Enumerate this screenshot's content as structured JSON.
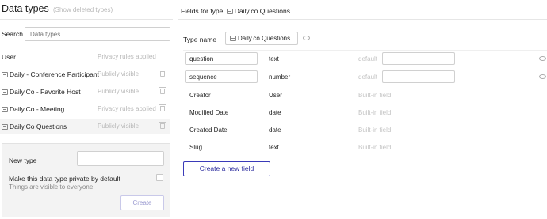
{
  "left": {
    "title": "Data types",
    "show_deleted": "(Show deleted types)",
    "search": {
      "label": "Search",
      "placeholder": "Data types"
    },
    "types": [
      {
        "name": "User",
        "status": "Privacy rules applied",
        "icon": false,
        "trash": false
      },
      {
        "name": "Daily - Conference Participant",
        "status": "Publicly visible",
        "icon": true,
        "trash": true
      },
      {
        "name": "Daily.Co - Favorite Host",
        "status": "Publicly visible",
        "icon": true,
        "trash": true
      },
      {
        "name": "Daily.Co - Meeting",
        "status": "Privacy rules applied",
        "icon": true,
        "trash": true
      },
      {
        "name": "Daily.Co Questions",
        "status": "Publicly visible",
        "icon": true,
        "trash": true,
        "selected": true
      }
    ],
    "new_type": {
      "label": "New type",
      "private_label": "Make this data type private by default",
      "private_sub": "Things are visible to everyone",
      "create_label": "Create"
    }
  },
  "right": {
    "fields_title_prefix": "Fields for type",
    "fields_title_type": "Daily.co Questions",
    "type_name_label": "Type name",
    "type_name_value": "Daily.co Questions",
    "custom_fields": [
      {
        "name": "question",
        "type": "text",
        "default_label": "default"
      },
      {
        "name": "sequence",
        "type": "number",
        "default_label": "default"
      }
    ],
    "builtin_fields": [
      {
        "name": "Creator",
        "type": "User",
        "note": "Built-in field"
      },
      {
        "name": "Modified Date",
        "type": "date",
        "note": "Built-in field"
      },
      {
        "name": "Created Date",
        "type": "date",
        "note": "Built-in field"
      },
      {
        "name": "Slug",
        "type": "text",
        "note": "Built-in field"
      }
    ],
    "new_field_label": "Create a new field"
  },
  "colors": {
    "accent": "#2d2d9f",
    "muted": "#b8b8b8",
    "panel_bg": "#f3f3f3"
  },
  "icons": [
    "database-icon",
    "trash-icon",
    "comment-icon"
  ]
}
